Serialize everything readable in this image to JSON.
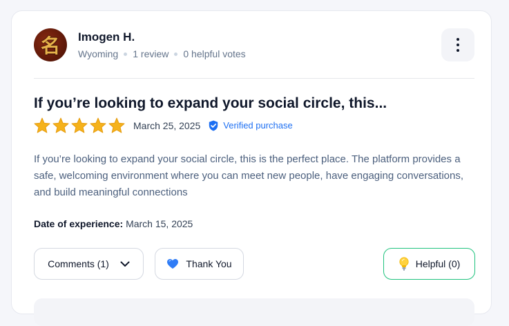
{
  "reviewer": {
    "name": "Imogen H.",
    "location": "Wyoming",
    "reviews": "1 review",
    "helpful_votes": "0 helpful votes",
    "avatar_glyph": "名"
  },
  "review": {
    "title": "If you’re looking to expand your social circle, this...",
    "rating": 5,
    "max_rating": 5,
    "date": "March 25, 2025",
    "verified_label": "Verified purchase",
    "body": "If you’re looking to expand your social circle, this is the perfect place. The platform provides a safe, welcoming environment where you can meet new people, have engaging conversations, and build meaningful connections",
    "experience_label": "Date of experience:",
    "experience_date": "March 15, 2025"
  },
  "actions": {
    "comments_label": "Comments (1)",
    "thank_you_label": "Thank You",
    "helpful_label": "Helpful (0)"
  },
  "colors": {
    "star": "#f5b21b",
    "verified": "#1d6ff2",
    "helpful_border": "#1ec27d",
    "heart": "#2f7cf6"
  },
  "icons": {
    "more": "more-vertical-icon",
    "verified": "shield-check-icon",
    "comments_toggle": "chevron-down-icon",
    "thank_you": "blue-heart-icon",
    "helpful": "light-bulb-icon"
  }
}
